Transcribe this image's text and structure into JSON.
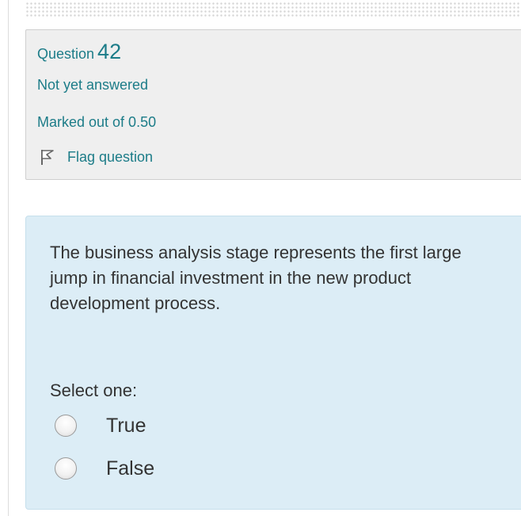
{
  "question": {
    "label": "Question",
    "number": "42",
    "state": "Not yet answered",
    "grade": "Marked out of 0.50",
    "flag_label": "Flag question",
    "text": "The business analysis stage represents the first large jump in financial investment in the new product development process.",
    "prompt": "Select one:",
    "options": [
      {
        "label": "True",
        "selected": false
      },
      {
        "label": "False",
        "selected": false
      }
    ]
  },
  "colors": {
    "info_background": "#efefef",
    "info_text": "#1c7c88",
    "content_background": "#dcedf6",
    "content_text": "#333333"
  },
  "icons": {
    "flag": "flag-icon",
    "radio": "radio-button"
  }
}
